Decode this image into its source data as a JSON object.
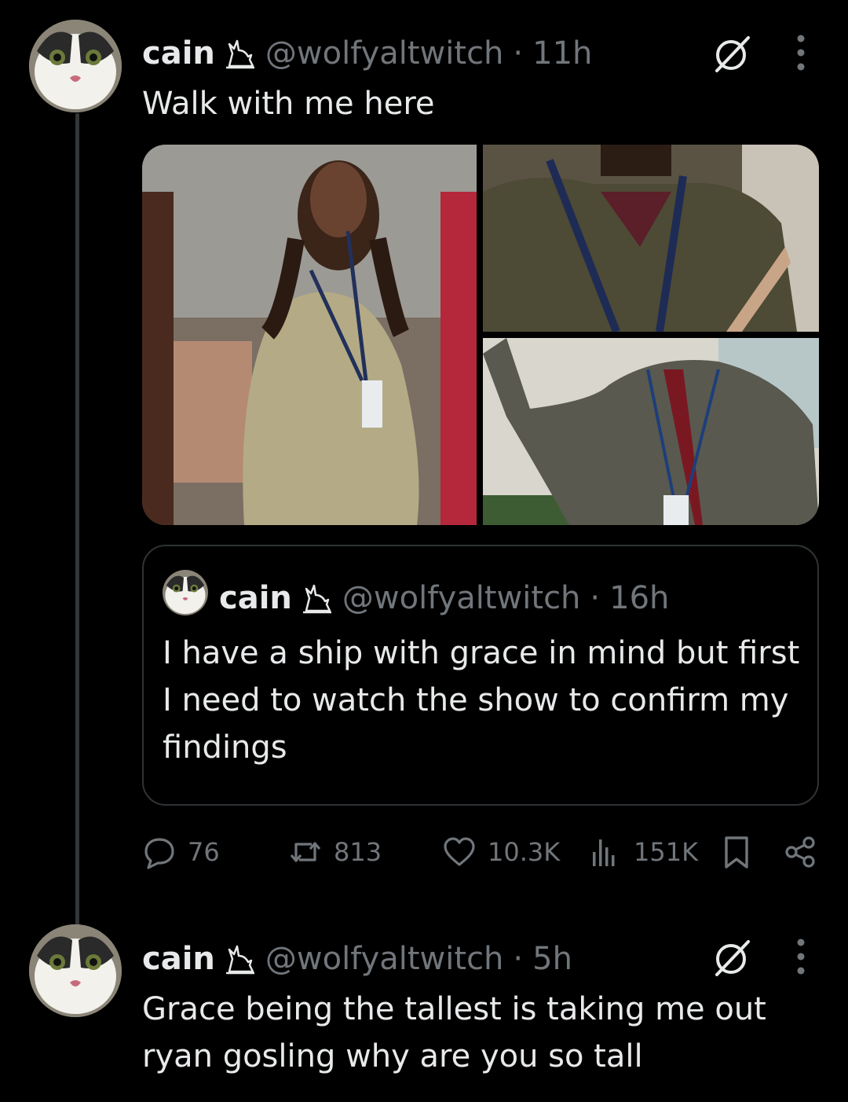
{
  "tweets": [
    {
      "name": "cain",
      "handle": "@wolfyaltwitch",
      "separator": "·",
      "time": "11h",
      "text": "Walk with me here"
    },
    {
      "name": "cain",
      "handle": "@wolfyaltwitch",
      "separator": "·",
      "time": "5h",
      "text_lines": [
        "Grace being the tallest is taking me out",
        "ryan gosling why are you so tall"
      ]
    }
  ],
  "quote": {
    "name": "cain",
    "handle": "@wolfyaltwitch",
    "separator": "·",
    "time": "16h",
    "text_lines": [
      "I have a ship with grace in mind but first",
      "I need to watch the show to confirm my",
      "findings"
    ]
  },
  "actions": {
    "replies": "76",
    "reposts": "813",
    "likes": "10.3K",
    "views": "151K"
  },
  "icons": {
    "badge": "cat-silhouette-icon",
    "reply": "speech-bubble-icon",
    "repost": "repost-arrows-icon",
    "like": "heart-icon",
    "views": "bar-chart-icon",
    "bookmark": "bookmark-icon",
    "share": "share-nodes-icon",
    "grok": "slashed-circle-icon",
    "more": "vertical-dots-icon"
  },
  "colors": {
    "background": "#000000",
    "text": "#e7e9ea",
    "secondary": "#71767b",
    "border": "#2f3336"
  }
}
